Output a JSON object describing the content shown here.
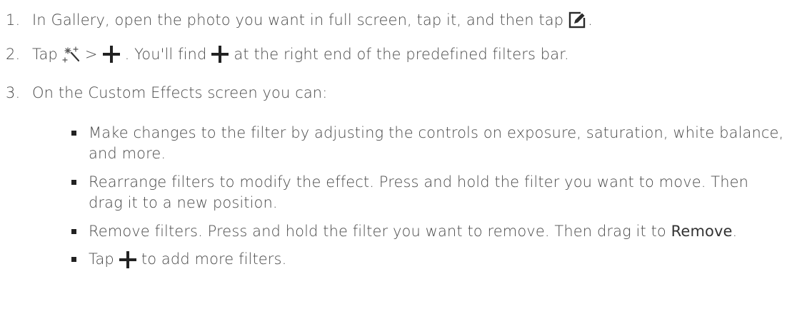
{
  "steps": [
    {
      "number": "1.",
      "text_before_icon": "In Gallery, open the photo you want in full screen, tap it, and then tap",
      "text_after_icon": "."
    },
    {
      "number": "2.",
      "text_before_icon_1": "Tap",
      "text_between_icons": ">",
      "text_after_icon_2": ". You'll find",
      "text_end": "at the right end of the predefined filters bar."
    },
    {
      "number": "3.",
      "text": "On the Custom Effects screen you can:"
    }
  ],
  "bullets": [
    {
      "text": "Make changes to the filter by adjusting the controls on exposure, saturation, white balance, and more."
    },
    {
      "text": "Rearrange filters to modify the effect. Press and hold the filter you want to move. Then drag it to a new position."
    },
    {
      "text_before": "Remove filters. Press and hold the filter you want to remove. Then drag it to",
      "bold": "Remove",
      "text_after": "."
    },
    {
      "text_before": "Tap",
      "text_after": "to add more filters."
    }
  ],
  "icons": {
    "edit": "edit-icon",
    "magic_wand": "magic-wand-icon",
    "plus": "plus-icon"
  }
}
